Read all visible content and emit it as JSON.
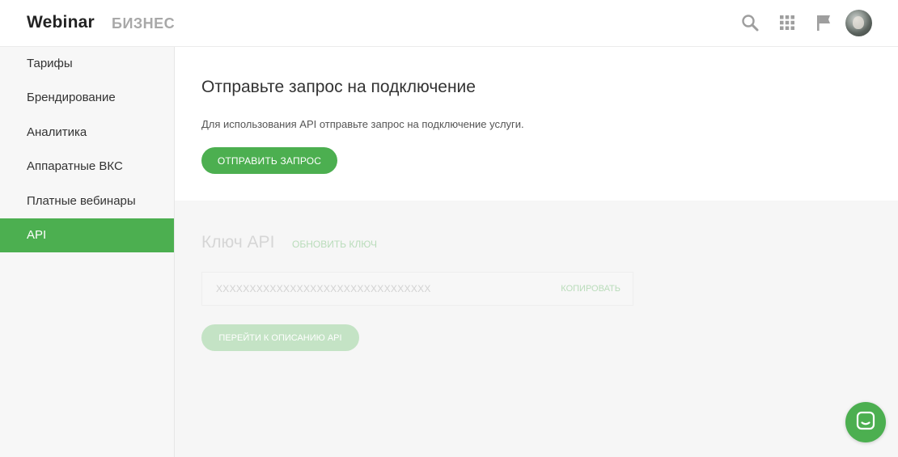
{
  "header": {
    "logo": "Webinar",
    "logo_sub": "БИЗНЕС",
    "icons": [
      "search-icon",
      "apps-grid-icon",
      "flag-icon",
      "avatar"
    ]
  },
  "sidebar": {
    "items": [
      {
        "label": "Тарифы",
        "active": false
      },
      {
        "label": "Брендирование",
        "active": false
      },
      {
        "label": "Аналитика",
        "active": false
      },
      {
        "label": "Аппаратные ВКС",
        "active": false
      },
      {
        "label": "Платные вебинары",
        "active": false
      },
      {
        "label": "API",
        "active": true
      }
    ]
  },
  "request": {
    "title": "Отправьте запрос на подключение",
    "description": "Для использования API отправьте запрос на подключение услуги.",
    "button": "ОТПРАВИТЬ ЗАПРОС"
  },
  "api_key": {
    "title": "Ключ API",
    "refresh_link": "ОБНОВИТЬ КЛЮЧ",
    "value": "XXXXXXXXXXXXXXXXXXXXXXXXXXXXXXXX",
    "copy_link": "КОПИРОВАТЬ",
    "docs_button": "ПЕРЕЙТИ К ОПИСАНИЮ API"
  },
  "colors": {
    "accent": "#4caf50",
    "accent_disabled": "#c4e3c5"
  }
}
